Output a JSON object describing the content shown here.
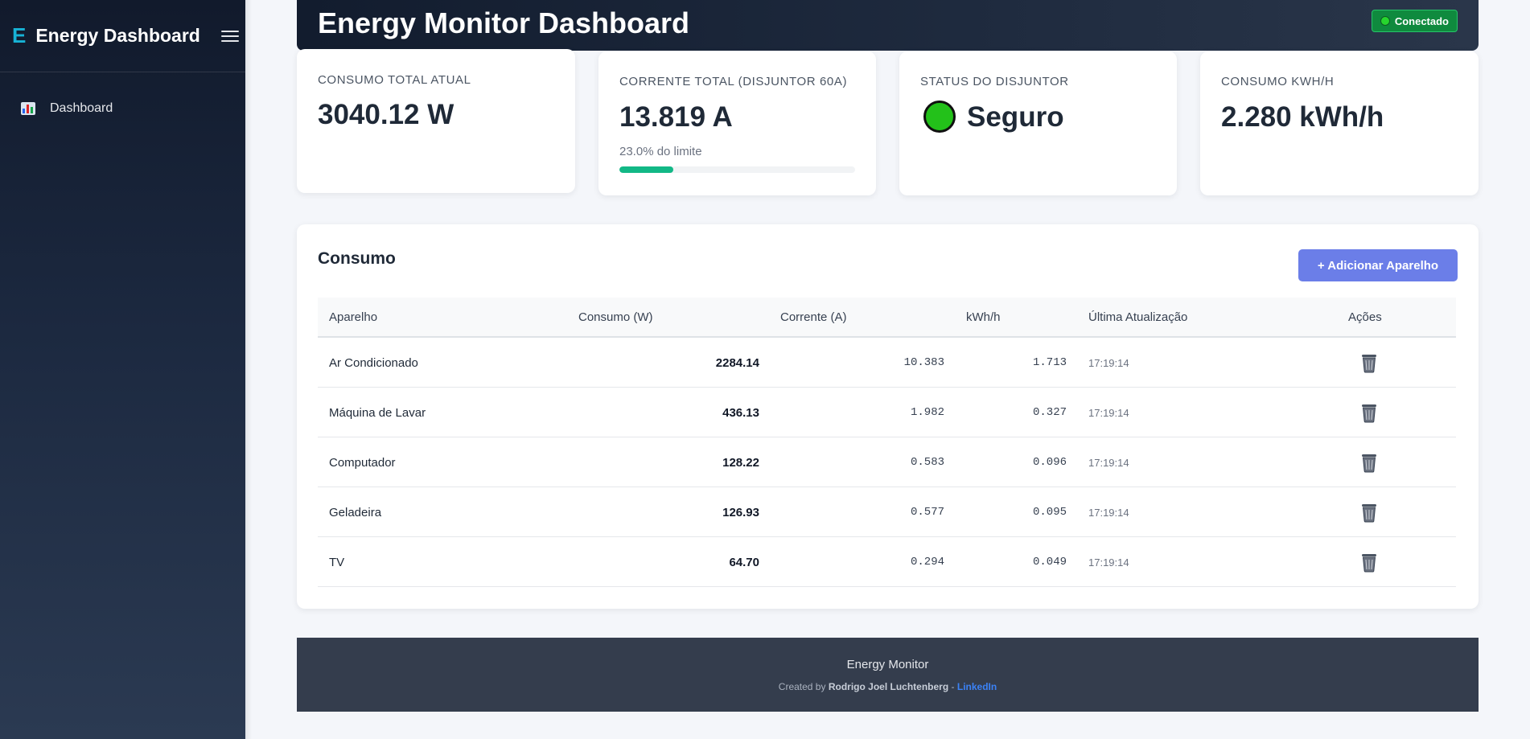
{
  "sidebar": {
    "logo_letter": "E",
    "brand": "Energy Dashboard",
    "nav": [
      {
        "icon": "bar-chart-icon",
        "label": "Dashboard"
      }
    ]
  },
  "header": {
    "title": "Energy Monitor Dashboard",
    "status": "Conectado",
    "status_color": "#0f8a3e"
  },
  "cards": {
    "total_power": {
      "label": "CONSUMO TOTAL ATUAL",
      "value": "3040.12 W"
    },
    "total_current": {
      "label": "CORRENTE TOTAL (DISJUNTOR 60A)",
      "value": "13.819 A",
      "sub": "23.0% do limite",
      "percent": 23.0
    },
    "breaker": {
      "label": "STATUS DO DISJUNTOR",
      "value": "Seguro",
      "indicator_color": "#23c11a"
    },
    "kwh": {
      "label": "CONSUMO KWH/H",
      "value": "2.280 kWh/h"
    }
  },
  "consumption": {
    "title": "Consumo",
    "add_button": "+ Adicionar Aparelho",
    "columns": [
      "Aparelho",
      "Consumo (W)",
      "Corrente (A)",
      "kWh/h",
      "Última Atualização",
      "Ações"
    ],
    "rows": [
      {
        "name": "Ar Condicionado",
        "power": "2284.14",
        "current": "10.383",
        "kwh": "1.713",
        "updated": "17:19:14"
      },
      {
        "name": "Máquina de Lavar",
        "power": "436.13",
        "current": "1.982",
        "kwh": "0.327",
        "updated": "17:19:14"
      },
      {
        "name": "Computador",
        "power": "128.22",
        "current": "0.583",
        "kwh": "0.096",
        "updated": "17:19:14"
      },
      {
        "name": "Geladeira",
        "power": "126.93",
        "current": "0.577",
        "kwh": "0.095",
        "updated": "17:19:14"
      },
      {
        "name": "TV",
        "power": "64.70",
        "current": "0.294",
        "kwh": "0.049",
        "updated": "17:19:14"
      }
    ]
  },
  "footer": {
    "title": "Energy Monitor",
    "created_by": "Created by",
    "author": "Rodrigo Joel Luchtenberg",
    "separator": "-",
    "link": "LinkedIn"
  }
}
